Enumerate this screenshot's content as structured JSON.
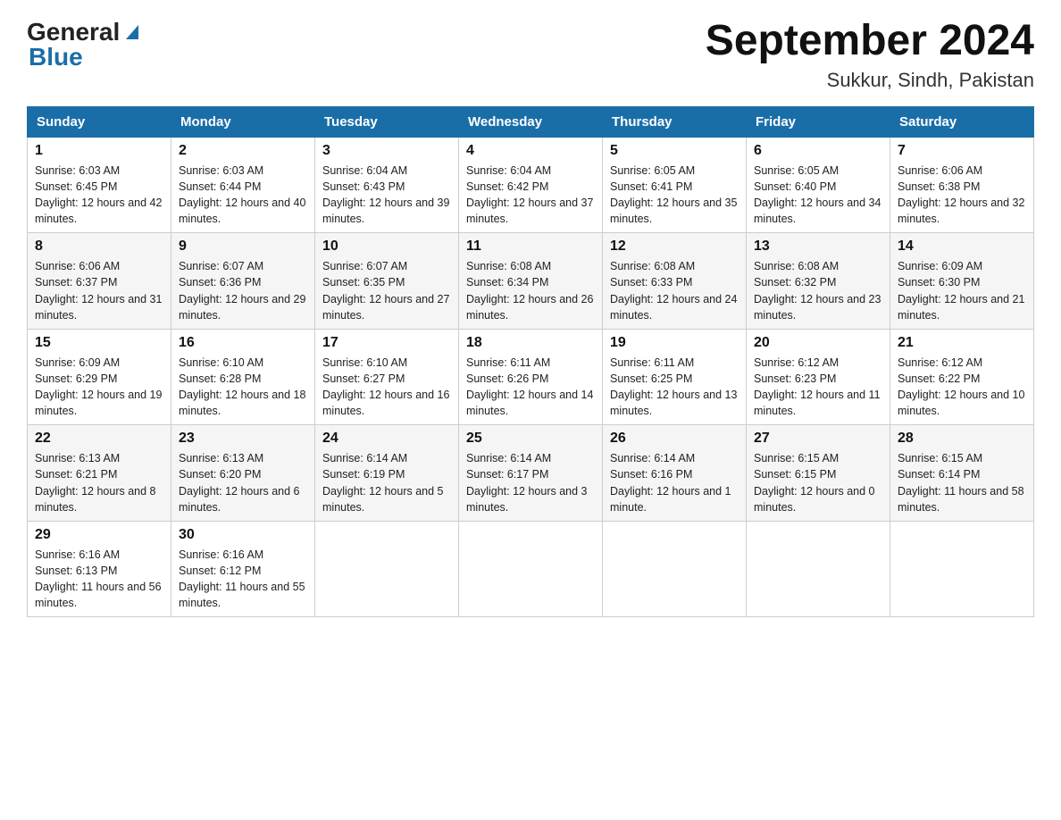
{
  "header": {
    "logo_general": "General",
    "logo_blue": "Blue",
    "title": "September 2024",
    "subtitle": "Sukkur, Sindh, Pakistan"
  },
  "days_of_week": [
    "Sunday",
    "Monday",
    "Tuesday",
    "Wednesday",
    "Thursday",
    "Friday",
    "Saturday"
  ],
  "weeks": [
    [
      {
        "day": "1",
        "sunrise": "Sunrise: 6:03 AM",
        "sunset": "Sunset: 6:45 PM",
        "daylight": "Daylight: 12 hours and 42 minutes."
      },
      {
        "day": "2",
        "sunrise": "Sunrise: 6:03 AM",
        "sunset": "Sunset: 6:44 PM",
        "daylight": "Daylight: 12 hours and 40 minutes."
      },
      {
        "day": "3",
        "sunrise": "Sunrise: 6:04 AM",
        "sunset": "Sunset: 6:43 PM",
        "daylight": "Daylight: 12 hours and 39 minutes."
      },
      {
        "day": "4",
        "sunrise": "Sunrise: 6:04 AM",
        "sunset": "Sunset: 6:42 PM",
        "daylight": "Daylight: 12 hours and 37 minutes."
      },
      {
        "day": "5",
        "sunrise": "Sunrise: 6:05 AM",
        "sunset": "Sunset: 6:41 PM",
        "daylight": "Daylight: 12 hours and 35 minutes."
      },
      {
        "day": "6",
        "sunrise": "Sunrise: 6:05 AM",
        "sunset": "Sunset: 6:40 PM",
        "daylight": "Daylight: 12 hours and 34 minutes."
      },
      {
        "day": "7",
        "sunrise": "Sunrise: 6:06 AM",
        "sunset": "Sunset: 6:38 PM",
        "daylight": "Daylight: 12 hours and 32 minutes."
      }
    ],
    [
      {
        "day": "8",
        "sunrise": "Sunrise: 6:06 AM",
        "sunset": "Sunset: 6:37 PM",
        "daylight": "Daylight: 12 hours and 31 minutes."
      },
      {
        "day": "9",
        "sunrise": "Sunrise: 6:07 AM",
        "sunset": "Sunset: 6:36 PM",
        "daylight": "Daylight: 12 hours and 29 minutes."
      },
      {
        "day": "10",
        "sunrise": "Sunrise: 6:07 AM",
        "sunset": "Sunset: 6:35 PM",
        "daylight": "Daylight: 12 hours and 27 minutes."
      },
      {
        "day": "11",
        "sunrise": "Sunrise: 6:08 AM",
        "sunset": "Sunset: 6:34 PM",
        "daylight": "Daylight: 12 hours and 26 minutes."
      },
      {
        "day": "12",
        "sunrise": "Sunrise: 6:08 AM",
        "sunset": "Sunset: 6:33 PM",
        "daylight": "Daylight: 12 hours and 24 minutes."
      },
      {
        "day": "13",
        "sunrise": "Sunrise: 6:08 AM",
        "sunset": "Sunset: 6:32 PM",
        "daylight": "Daylight: 12 hours and 23 minutes."
      },
      {
        "day": "14",
        "sunrise": "Sunrise: 6:09 AM",
        "sunset": "Sunset: 6:30 PM",
        "daylight": "Daylight: 12 hours and 21 minutes."
      }
    ],
    [
      {
        "day": "15",
        "sunrise": "Sunrise: 6:09 AM",
        "sunset": "Sunset: 6:29 PM",
        "daylight": "Daylight: 12 hours and 19 minutes."
      },
      {
        "day": "16",
        "sunrise": "Sunrise: 6:10 AM",
        "sunset": "Sunset: 6:28 PM",
        "daylight": "Daylight: 12 hours and 18 minutes."
      },
      {
        "day": "17",
        "sunrise": "Sunrise: 6:10 AM",
        "sunset": "Sunset: 6:27 PM",
        "daylight": "Daylight: 12 hours and 16 minutes."
      },
      {
        "day": "18",
        "sunrise": "Sunrise: 6:11 AM",
        "sunset": "Sunset: 6:26 PM",
        "daylight": "Daylight: 12 hours and 14 minutes."
      },
      {
        "day": "19",
        "sunrise": "Sunrise: 6:11 AM",
        "sunset": "Sunset: 6:25 PM",
        "daylight": "Daylight: 12 hours and 13 minutes."
      },
      {
        "day": "20",
        "sunrise": "Sunrise: 6:12 AM",
        "sunset": "Sunset: 6:23 PM",
        "daylight": "Daylight: 12 hours and 11 minutes."
      },
      {
        "day": "21",
        "sunrise": "Sunrise: 6:12 AM",
        "sunset": "Sunset: 6:22 PM",
        "daylight": "Daylight: 12 hours and 10 minutes."
      }
    ],
    [
      {
        "day": "22",
        "sunrise": "Sunrise: 6:13 AM",
        "sunset": "Sunset: 6:21 PM",
        "daylight": "Daylight: 12 hours and 8 minutes."
      },
      {
        "day": "23",
        "sunrise": "Sunrise: 6:13 AM",
        "sunset": "Sunset: 6:20 PM",
        "daylight": "Daylight: 12 hours and 6 minutes."
      },
      {
        "day": "24",
        "sunrise": "Sunrise: 6:14 AM",
        "sunset": "Sunset: 6:19 PM",
        "daylight": "Daylight: 12 hours and 5 minutes."
      },
      {
        "day": "25",
        "sunrise": "Sunrise: 6:14 AM",
        "sunset": "Sunset: 6:17 PM",
        "daylight": "Daylight: 12 hours and 3 minutes."
      },
      {
        "day": "26",
        "sunrise": "Sunrise: 6:14 AM",
        "sunset": "Sunset: 6:16 PM",
        "daylight": "Daylight: 12 hours and 1 minute."
      },
      {
        "day": "27",
        "sunrise": "Sunrise: 6:15 AM",
        "sunset": "Sunset: 6:15 PM",
        "daylight": "Daylight: 12 hours and 0 minutes."
      },
      {
        "day": "28",
        "sunrise": "Sunrise: 6:15 AM",
        "sunset": "Sunset: 6:14 PM",
        "daylight": "Daylight: 11 hours and 58 minutes."
      }
    ],
    [
      {
        "day": "29",
        "sunrise": "Sunrise: 6:16 AM",
        "sunset": "Sunset: 6:13 PM",
        "daylight": "Daylight: 11 hours and 56 minutes."
      },
      {
        "day": "30",
        "sunrise": "Sunrise: 6:16 AM",
        "sunset": "Sunset: 6:12 PM",
        "daylight": "Daylight: 11 hours and 55 minutes."
      },
      null,
      null,
      null,
      null,
      null
    ]
  ]
}
